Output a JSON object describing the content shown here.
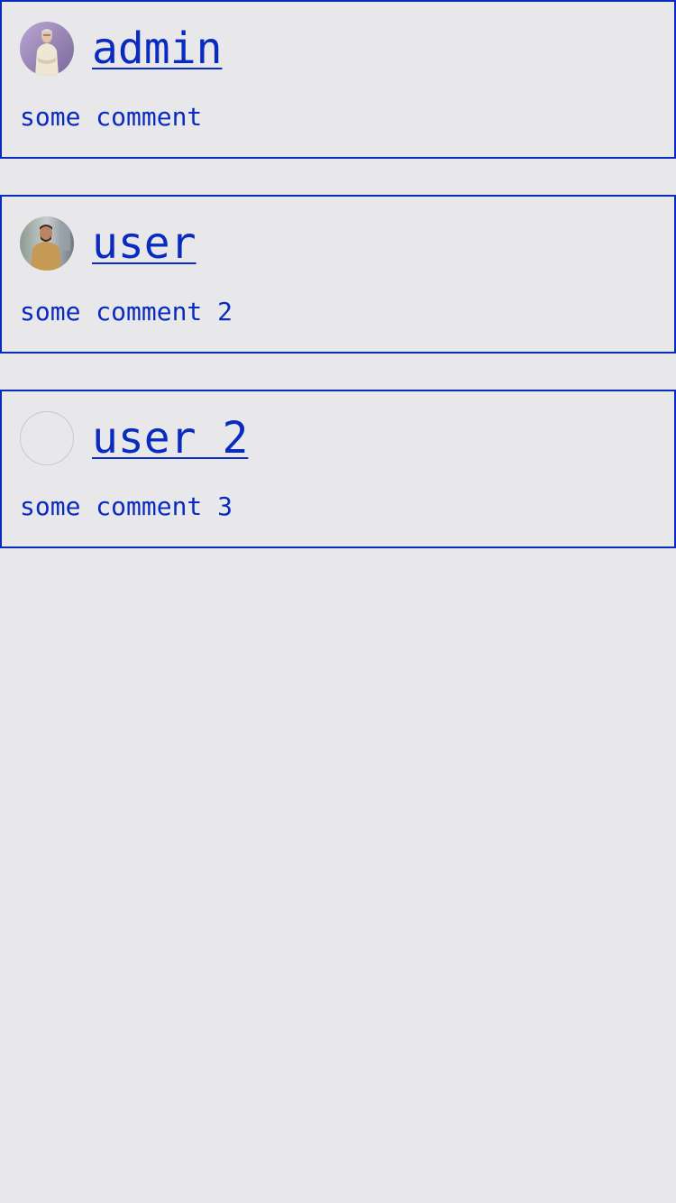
{
  "comments": [
    {
      "username": "admin",
      "text": "some comment",
      "avatar": "admin-avatar-photo"
    },
    {
      "username": "user",
      "text": "some comment 2",
      "avatar": "user-avatar-photo"
    },
    {
      "username": "user 2",
      "text": "some comment 3",
      "avatar": "empty-avatar-placeholder"
    }
  ],
  "colors": {
    "background": "#e8e7ea",
    "accent": "#0a2bbf"
  }
}
